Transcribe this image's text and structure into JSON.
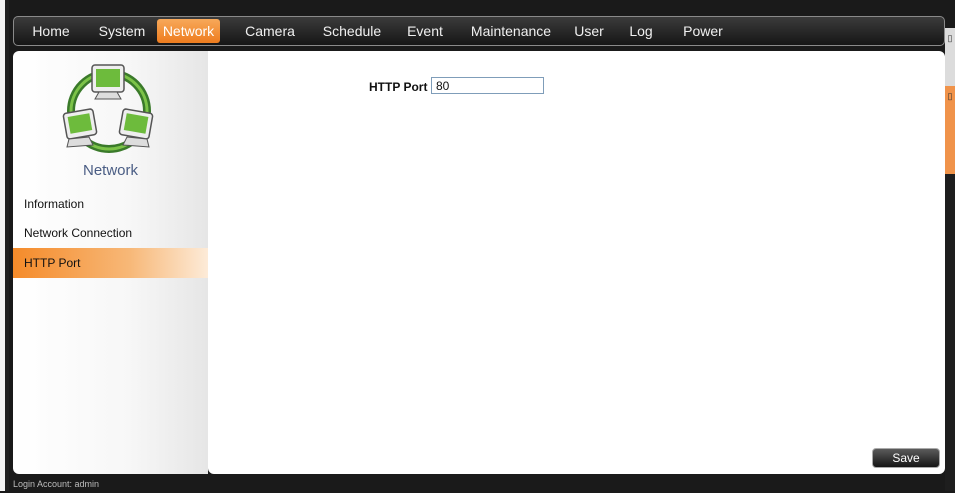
{
  "nav": {
    "items": [
      "Home",
      "System",
      "Network",
      "Camera",
      "Schedule",
      "Event",
      "Maintenance",
      "User",
      "Log",
      "Power"
    ],
    "active": "Network"
  },
  "sidebar": {
    "title": "Network",
    "items": [
      "Information",
      "Network Connection",
      "HTTP Port"
    ],
    "active": "HTTP Port"
  },
  "form": {
    "http_port_label": "HTTP Port",
    "http_port_value": "80"
  },
  "buttons": {
    "save_label": "Save"
  },
  "footer": {
    "login_text": "Login Account: admin"
  },
  "colors": {
    "accent": "#f28a2e",
    "nav_bg": "#262626",
    "sidebar_title": "#4a5d84"
  }
}
